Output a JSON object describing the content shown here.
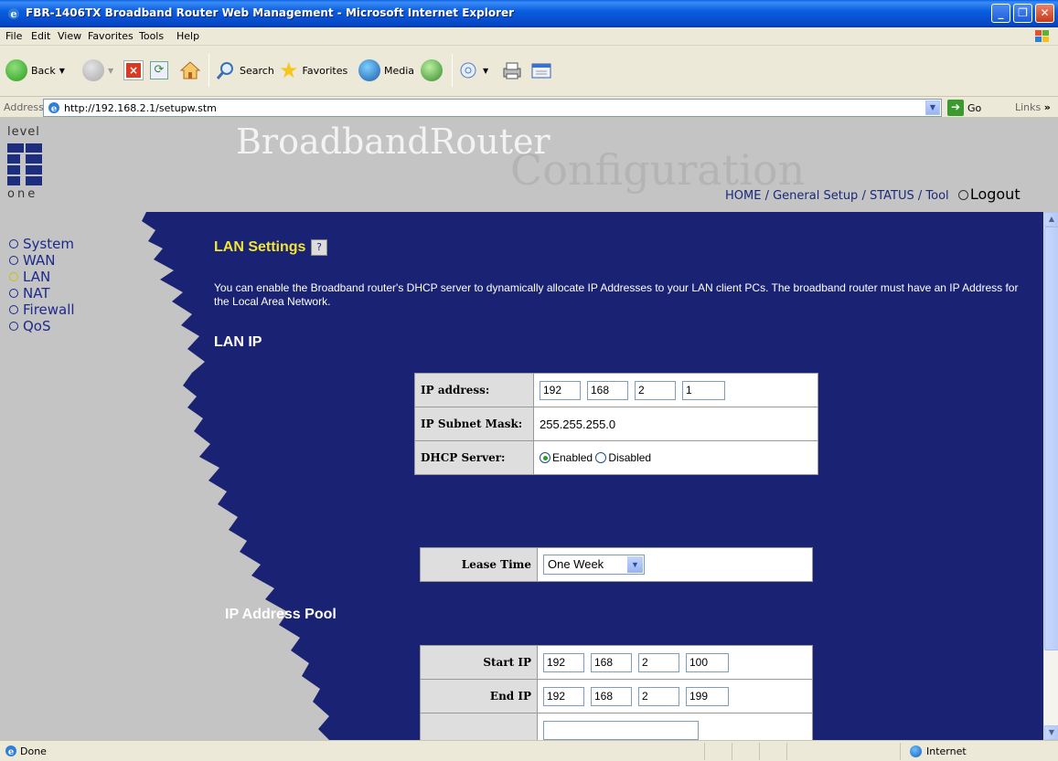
{
  "window": {
    "title": "FBR-1406TX Broadband Router Web Management - Microsoft Internet Explorer"
  },
  "menu": [
    "File",
    "Edit",
    "View",
    "Favorites",
    "Tools",
    "Help"
  ],
  "toolbar": {
    "back": "Back",
    "search": "Search",
    "favorites": "Favorites",
    "media": "Media"
  },
  "address": {
    "label": "Address",
    "url": "http://192.168.2.1/setupw.stm",
    "go": "Go",
    "links": "Links"
  },
  "header": {
    "logo_top": "level",
    "logo_bottom": "one",
    "brand": "BroadbandRouter",
    "brand_sub": "Configuration",
    "nav": {
      "home": "HOME",
      "general": "General Setup",
      "status": "STATUS",
      "tool": "Tool",
      "logout": "Logout"
    }
  },
  "sidebar": {
    "items": [
      {
        "label": "System"
      },
      {
        "label": "WAN"
      },
      {
        "label": "LAN"
      },
      {
        "label": "NAT"
      },
      {
        "label": "Firewall"
      },
      {
        "label": "QoS"
      }
    ],
    "active": "LAN"
  },
  "main": {
    "title": "LAN Settings",
    "description": "You can enable the Broadband router's DHCP server to dynamically allocate IP Addresses to your LAN client PCs. The broadband router must have an IP Address for the Local Area Network.",
    "lan_ip_heading": "LAN IP",
    "pool_heading": "IP Address Pool",
    "lan_table": {
      "ip_label": "IP address:",
      "ip": [
        "192",
        "168",
        "2",
        "1"
      ],
      "mask_label": "IP Subnet Mask:",
      "mask": "255.255.255.0",
      "dhcp_label": "DHCP Server:",
      "enabled": "Enabled",
      "disabled": "Disabled",
      "dhcp_selected": "Enabled"
    },
    "lease": {
      "label": "Lease Time",
      "value": "One Week"
    },
    "pool": {
      "start_label": "Start IP",
      "start": [
        "192",
        "168",
        "2",
        "100"
      ],
      "end_label": "End IP",
      "end": [
        "192",
        "168",
        "2",
        "199"
      ]
    }
  },
  "status": {
    "left": "Done",
    "zone": "Internet"
  }
}
